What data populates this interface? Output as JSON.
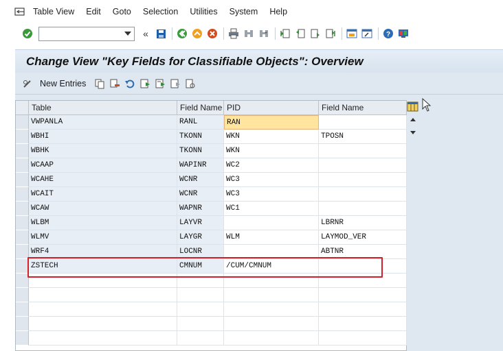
{
  "menu": [
    "Table View",
    "Edit",
    "Goto",
    "Selection",
    "Utilities",
    "System",
    "Help"
  ],
  "command_field": {
    "value": "",
    "placeholder": ""
  },
  "title": "Change View \"Key Fields for Classifiable Objects\": Overview",
  "app_toolbar": {
    "new_entries": "New Entries"
  },
  "table": {
    "headers": [
      "Table",
      "Field Name",
      "PID",
      "Field Name"
    ],
    "rows": [
      [
        "VWPANLA",
        "RANL",
        "RAN",
        ""
      ],
      [
        "WBHI",
        "TKONN",
        "WKN",
        "TPOSN"
      ],
      [
        "WBHK",
        "TKONN",
        "WKN",
        ""
      ],
      [
        "WCAAP",
        "WAPINR",
        "WC2",
        ""
      ],
      [
        "WCAHE",
        "WCNR",
        "WC3",
        ""
      ],
      [
        "WCAIT",
        "WCNR",
        "WC3",
        ""
      ],
      [
        "WCAW",
        "WAPNR",
        "WC1",
        ""
      ],
      [
        "WLBM",
        "LAYVR",
        "",
        "LBRNR"
      ],
      [
        "WLMV",
        "LAYGR",
        "WLM",
        "LAYMOD_VER"
      ],
      [
        "WRF4",
        "LOCNR",
        "",
        "ABTNR"
      ],
      [
        "ZSTECH",
        "CMNUM",
        "/CUM/CMNUM",
        ""
      ],
      [
        "",
        "",
        "",
        ""
      ],
      [
        "",
        "",
        "",
        ""
      ],
      [
        "",
        "",
        "",
        ""
      ],
      [
        "",
        "",
        "",
        ""
      ],
      [
        "",
        "",
        "",
        ""
      ]
    ]
  },
  "colors": {
    "highlight": "#d0202a",
    "input_cell": "#ffe59e",
    "title_bg": "#dfe8f1"
  }
}
